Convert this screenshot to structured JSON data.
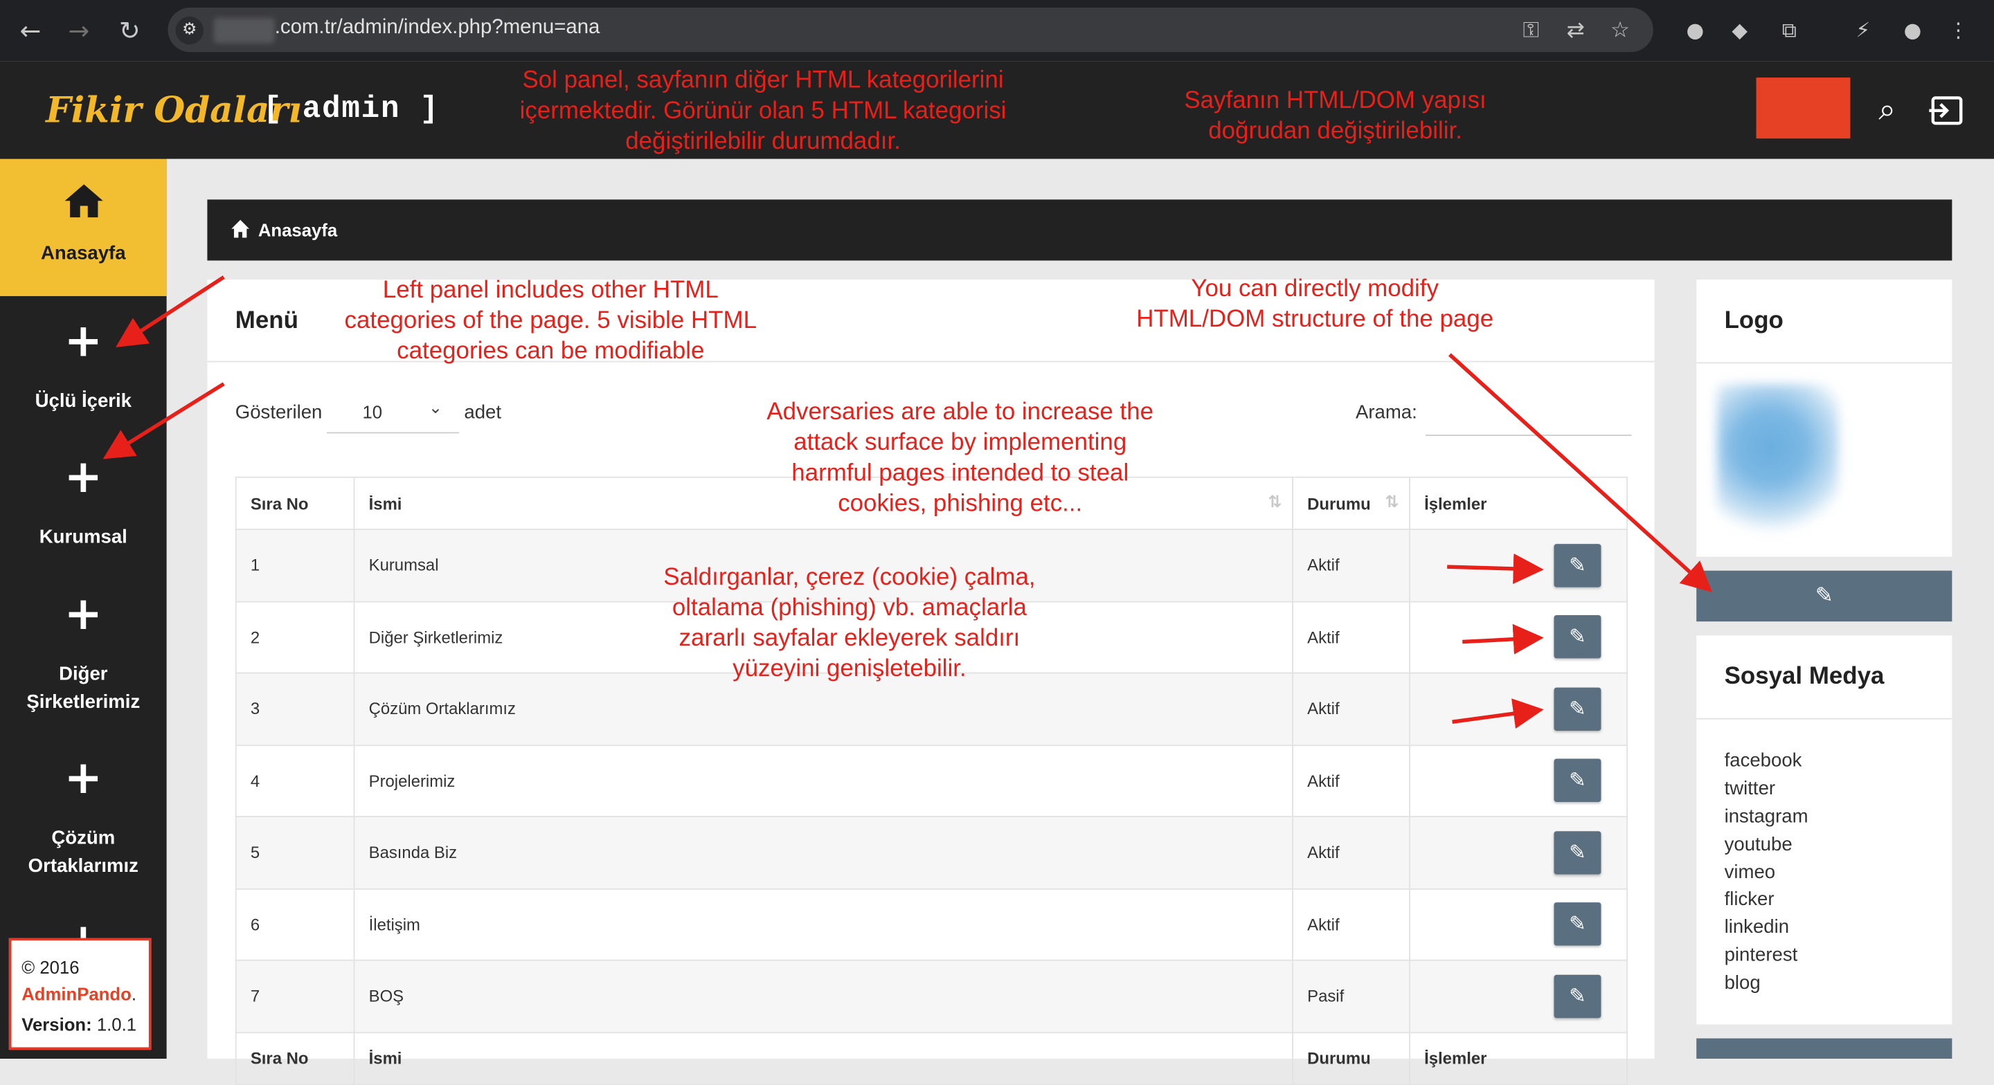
{
  "browser": {
    "url_suffix": ".com.tr/admin/index.php?menu=ana"
  },
  "header": {
    "logo_script": "Fikir Odaları",
    "logo_admin": "[ admin ]"
  },
  "sidebar": {
    "items": [
      {
        "label": "Anasayfa"
      },
      {
        "label": "Üçlü İçerik"
      },
      {
        "label": "Kurumsal"
      },
      {
        "label1": "Diğer",
        "label2": "Şirketlerimiz"
      },
      {
        "label1": "Çözüm",
        "label2": "Ortaklarımız"
      }
    ],
    "copyright": "© 2016",
    "brand": "AdminPando",
    "brand_suffix": ".",
    "version_label": "Version:",
    "version_value": "1.0.1"
  },
  "breadcrumb": {
    "label": "Anasayfa"
  },
  "menu_card": {
    "title": "Menü",
    "shown_label": "Gösterilen",
    "page_size": "10",
    "adet_label": "adet",
    "search_label": "Arama:",
    "columns": [
      "Sıra No",
      "İsmi",
      "Durumu",
      "İşlemler"
    ],
    "rows": [
      {
        "no": "1",
        "name": "Kurumsal",
        "status": "Aktif"
      },
      {
        "no": "2",
        "name": "Diğer Şirketlerimiz",
        "status": "Aktif"
      },
      {
        "no": "3",
        "name": "Çözüm Ortaklarımız",
        "status": "Aktif"
      },
      {
        "no": "4",
        "name": "Projelerimiz",
        "status": "Aktif"
      },
      {
        "no": "5",
        "name": "Basında Biz",
        "status": "Aktif"
      },
      {
        "no": "6",
        "name": "İletişim",
        "status": "Aktif"
      },
      {
        "no": "7",
        "name": "BOŞ",
        "status": "Pasif"
      }
    ]
  },
  "right": {
    "logo_title": "Logo",
    "social_title": "Sosyal Medya",
    "social_items": [
      "facebook",
      "twitter",
      "instagram",
      "youtube",
      "vimeo",
      "flicker",
      "linkedin",
      "pinterest",
      "blog"
    ]
  },
  "annotations": {
    "tr_left_1": "Sol panel, sayfanın diğer HTML kategorilerini",
    "tr_left_2": "içermektedir. Görünür olan 5 HTML kategorisi",
    "tr_left_3": "değiştirilebilir durumdadır.",
    "tr_right_1": "Sayfanın HTML/DOM yapısı",
    "tr_right_2": "doğrudan değiştirilebilir.",
    "en_left_1": "Left panel includes other HTML",
    "en_left_2": "categories of the page. 5 visible HTML",
    "en_left_3": "categories can be modifiable",
    "en_right_1": "You can directly modify",
    "en_right_2": "HTML/DOM structure of the page",
    "en_mid_1": "Adversaries are able to increase the",
    "en_mid_2": "attack surface by implementing",
    "en_mid_3": "harmful pages intended to steal",
    "en_mid_4": "cookies, phishing etc...",
    "tr_mid_1": "Saldırganlar, çerez (cookie) çalma,",
    "tr_mid_2": "oltalama (phishing) vb. amaçlarla",
    "tr_mid_3": "zararlı sayfalar ekleyerek saldırı",
    "tr_mid_4": "yüzeyini genişletebilir."
  },
  "colors": {
    "annotation_red": "#e8201a",
    "sidebar_active": "#f3bf32",
    "header_bg": "#222222",
    "edit_button": "#5a7081",
    "brand_red": "#e64125"
  }
}
